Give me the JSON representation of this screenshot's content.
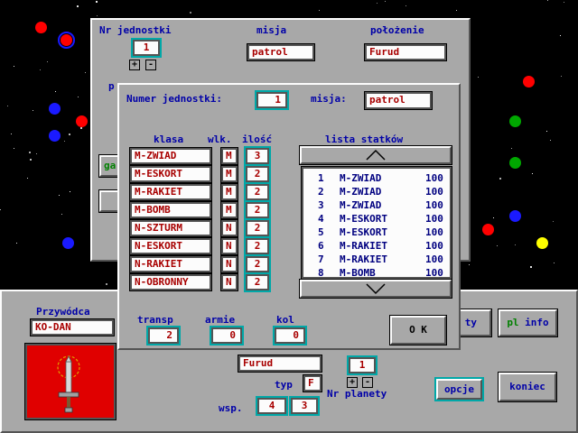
{
  "colors": {
    "panel": "#a8a8a8",
    "label": "#0000a8",
    "value": "#a80000",
    "accent": "#00a8a8",
    "flag": "#e00000",
    "planet_red": "#ff0000",
    "planet_blue": "#1a1aff",
    "planet_green": "#00a800",
    "planet_yellow": "#ffff00"
  },
  "back_dialog": {
    "unit_no_label": "Nr jednostki",
    "unit_no_value": "1",
    "mission_label": "misja",
    "mission_value": "patrol",
    "location_label": "położenie",
    "location_value": "Furud",
    "plus": "+",
    "minus": "-",
    "partial_left": "p",
    "partial_button": "ga"
  },
  "dialog": {
    "unit_number_label": "Numer jednostki:",
    "unit_number_value": "1",
    "mission_label": "misja:",
    "mission_value": "patrol",
    "columns": {
      "class": "klasa",
      "owner": "wlk.",
      "count": "ilość",
      "ships": "lista statków"
    },
    "classes": [
      {
        "name": "M-ZWIAD",
        "owner": "M",
        "count": "3"
      },
      {
        "name": "M-ESKORT",
        "owner": "M",
        "count": "2"
      },
      {
        "name": "M-RAKIET",
        "owner": "M",
        "count": "2"
      },
      {
        "name": "M-BOMB",
        "owner": "M",
        "count": "2"
      },
      {
        "name": "N-SZTURM",
        "owner": "N",
        "count": "2"
      },
      {
        "name": "N-ESKORT",
        "owner": "N",
        "count": "2"
      },
      {
        "name": "N-RAKIET",
        "owner": "N",
        "count": "2"
      },
      {
        "name": "N-OBRONNY",
        "owner": "N",
        "count": "2"
      }
    ],
    "ships": [
      {
        "no": "1",
        "name": "M-ZWIAD",
        "value": "100"
      },
      {
        "no": "2",
        "name": "M-ZWIAD",
        "value": "100"
      },
      {
        "no": "3",
        "name": "M-ZWIAD",
        "value": "100"
      },
      {
        "no": "4",
        "name": "M-ESKORT",
        "value": "100"
      },
      {
        "no": "5",
        "name": "M-ESKORT",
        "value": "100"
      },
      {
        "no": "6",
        "name": "M-RAKIET",
        "value": "100"
      },
      {
        "no": "7",
        "name": "M-RAKIET",
        "value": "100"
      },
      {
        "no": "8",
        "name": "M-BOMB",
        "value": "100"
      }
    ],
    "transp_label": "transp",
    "transp_value": "2",
    "armie_label": "armie",
    "armie_value": "0",
    "kol_label": "kol",
    "kol_value": "0",
    "ok_label": "O K"
  },
  "bottom": {
    "leader_label": "Przywódca",
    "leader_value": "KO-DAN",
    "planet_name": "Furud",
    "type_label": "typ",
    "type_value": "F",
    "planet_no_label": "Nr planety",
    "planet_no_value": "1",
    "coords_label": "wsp.",
    "coord_x": "4",
    "coord_y": "3",
    "plus": "+",
    "minus": "-",
    "partial_button": "ty",
    "info_button": "pl info",
    "options_button": "opcje",
    "end_button": "koniec"
  }
}
